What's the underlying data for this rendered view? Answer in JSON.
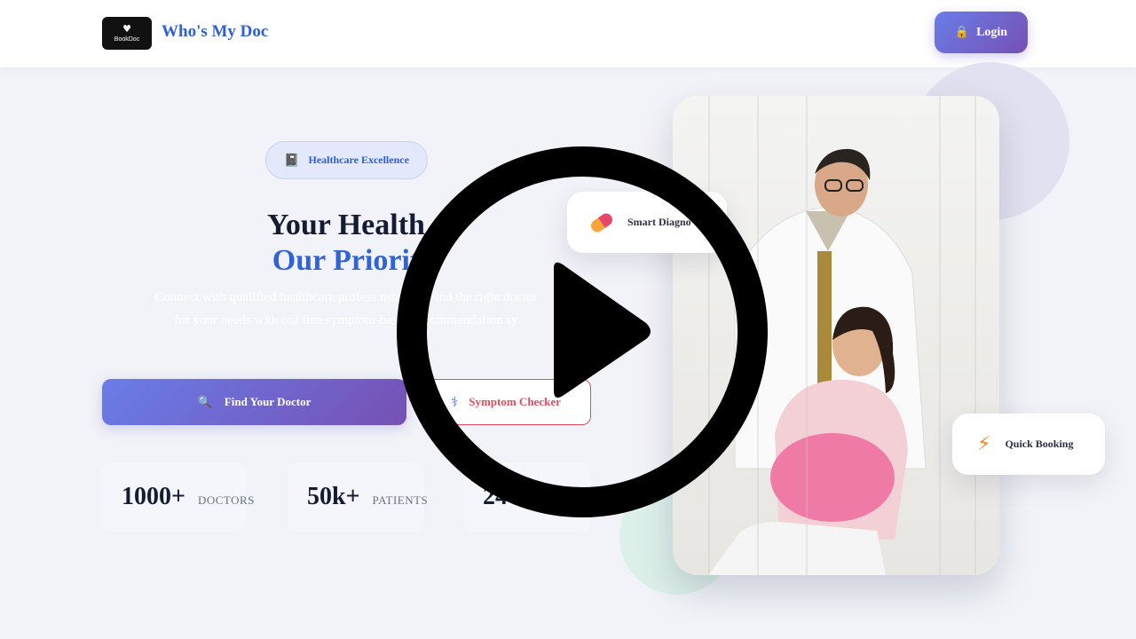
{
  "nav": {
    "logo_text": "BookDoc",
    "brand_name": "Who's My Doc",
    "login_label": "Login"
  },
  "hero": {
    "badge_label": "Healthcare Excellence",
    "title_line1": "Your Health",
    "title_line2": "Our Priorit",
    "description": "Connect with qualified healthcare profess      nstantly. Find the right doctor for your needs with our inte        symptom-based recommendation sy",
    "find_button_label": "Find Your Doctor",
    "symptom_button_label": "Symptom Checker"
  },
  "stats": [
    {
      "value": "1000+",
      "label": "DOCTORS"
    },
    {
      "value": "50k+",
      "label": "PATIENTS"
    },
    {
      "value": "24",
      "label": ""
    }
  ],
  "floating_cards": {
    "smart": "Smart Diagno",
    "quick": "Quick Booking"
  },
  "icons": {
    "logo": "heart-icon",
    "login": "lock-icon",
    "badge": "book-icon",
    "find": "magnifier-icon",
    "symptom": "stethoscope-icon",
    "smart": "pill-icon",
    "quick": "lightning-icon",
    "overlay": "play-icon"
  },
  "colors": {
    "brand_blue": "#2f5fd8",
    "gradient_start": "#6a7de8",
    "gradient_end": "#7650b4",
    "symptom_red": "#e84a5f",
    "title_dark": "#161b33"
  }
}
